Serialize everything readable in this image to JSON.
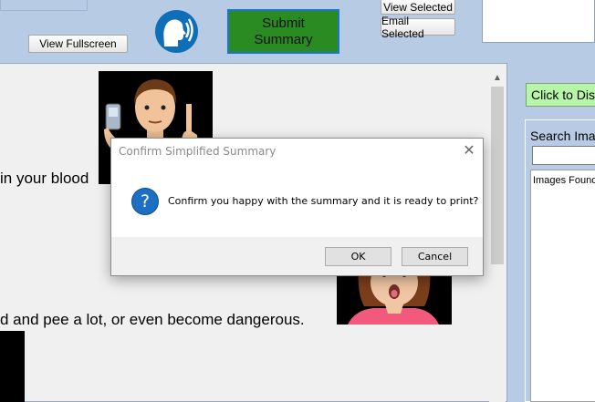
{
  "toolbar": {
    "view_fullscreen_label": "View Fullscreen",
    "submit_line1": "Submit",
    "submit_line2": "Summary",
    "view_selected_label": "View Selected",
    "email_selected_label": "Email Selected"
  },
  "document": {
    "line1": "in your blood",
    "line2": "d and pee a lot, or even become dangerous."
  },
  "right_panel": {
    "green_button_label": "Click to Disa",
    "search_label": "Search Imag",
    "search_value": "",
    "images_found_label": "Images Found"
  },
  "dialog": {
    "title": "Confirm Simplified Summary",
    "message": "Confirm you happy with the summary and it is ready to print?",
    "ok_label": "OK",
    "cancel_label": "Cancel",
    "icon_glyph": "?"
  },
  "icons": {
    "speak": "speaking-head-icon",
    "question": "question-icon",
    "close": "close-icon"
  },
  "colors": {
    "app_background": "#b8cbe4",
    "submit_green": "#2a8b23",
    "accent_blue": "#1c6fc2",
    "light_green": "#b7f5a8"
  }
}
